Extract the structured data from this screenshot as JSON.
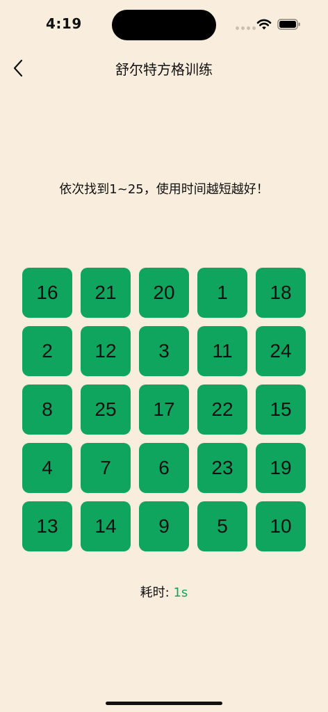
{
  "status_bar": {
    "time": "4:19"
  },
  "nav": {
    "title": "舒尔特方格训练"
  },
  "instruction": "依次找到1~25，使用时间越短越好！",
  "grid": {
    "cells": [
      "16",
      "21",
      "20",
      "1",
      "18",
      "2",
      "12",
      "3",
      "11",
      "24",
      "8",
      "25",
      "17",
      "22",
      "15",
      "4",
      "7",
      "6",
      "23",
      "19",
      "13",
      "14",
      "9",
      "5",
      "10"
    ]
  },
  "timer": {
    "label": "耗时: ",
    "value": "1s"
  },
  "colors": {
    "background": "#F9EEDD",
    "cell": "#0FA55E",
    "accent": "#0FA55E",
    "text": "#111111"
  },
  "icons": {
    "back": "chevron-left-icon",
    "wifi": "wifi-icon",
    "battery": "battery-icon",
    "signal": "cellular-signal-icon"
  }
}
